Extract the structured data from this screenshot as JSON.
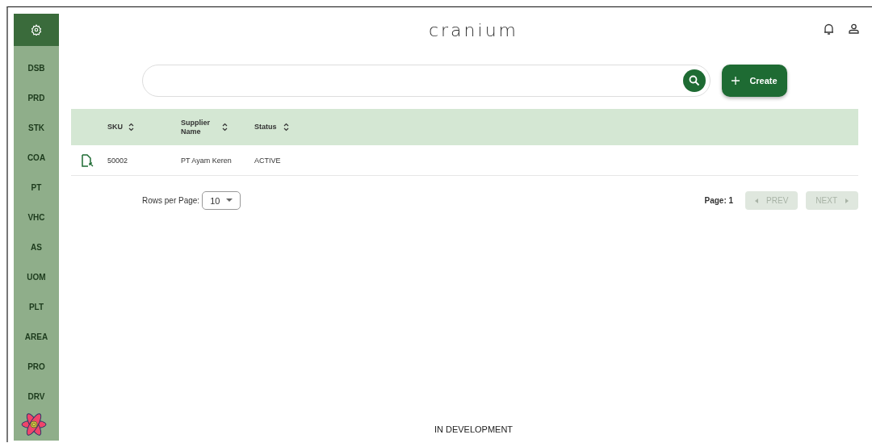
{
  "sidebar": {
    "items": [
      {
        "label": "DSB"
      },
      {
        "label": "PRD"
      },
      {
        "label": "STK"
      },
      {
        "label": "COA"
      },
      {
        "label": "PT"
      },
      {
        "label": "VHC"
      },
      {
        "label": "AS"
      },
      {
        "label": "UOM"
      },
      {
        "label": "PLT"
      },
      {
        "label": "AREA"
      },
      {
        "label": "PRO"
      },
      {
        "label": "DRV"
      }
    ]
  },
  "header": {
    "brand": "cranium"
  },
  "create_button": {
    "label": "Create"
  },
  "table": {
    "columns": [
      {
        "label": "SKU"
      },
      {
        "label": "Supplier Name"
      },
      {
        "label": "Status"
      }
    ],
    "rows": [
      {
        "cells": [
          "50002",
          "PT Ayam Keren",
          "ACTIVE"
        ]
      }
    ]
  },
  "pagination": {
    "rows_per_page_label": "Rows per Page:",
    "rows_per_page": "10",
    "page": "Page: 1",
    "prev": {
      "label": "PREV",
      "disabled": true
    },
    "next": {
      "label": "NEXT",
      "disabled": true
    }
  },
  "footer": "IN DEVELOPMENT"
}
